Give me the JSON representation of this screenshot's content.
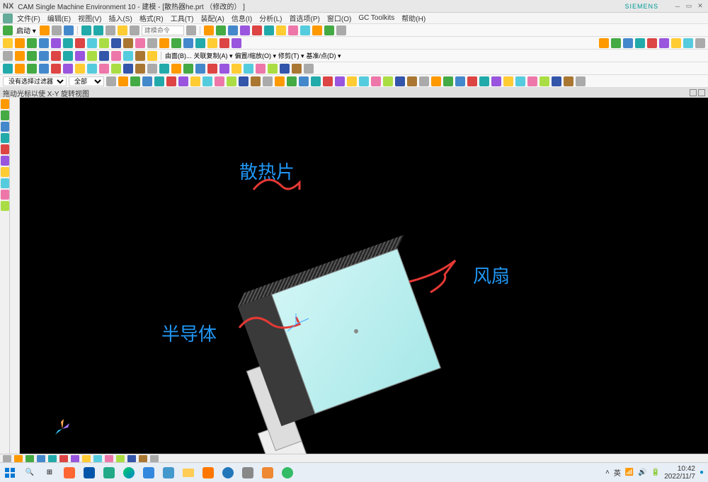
{
  "title": {
    "nx": "NX",
    "text": "CAM Single Machine Environment 10 - 建模 - [散热器he.prt （修改的） ]",
    "siemens": "SIEMENS"
  },
  "menu": {
    "items": [
      "文件(F)",
      "编辑(E)",
      "视图(V)",
      "插入(S)",
      "格式(R)",
      "工具(T)",
      "装配(A)",
      "信息(I)",
      "分析(L)",
      "首选项(P)",
      "窗口(O)",
      "GC Toolkits",
      "帮助(H)"
    ]
  },
  "toolbar1": {
    "start_label": "启动 ▾",
    "cmd_placeholder": "建模命令"
  },
  "toolbar2": {
    "labels": [
      "由面(B)...",
      "关联复制(A) ▾",
      "偏置/缩放(O) ▾",
      "修剪(T) ▾",
      "基准/点(D) ▾"
    ]
  },
  "filter": {
    "nofilter": "没有选择过滤器",
    "all": "全部"
  },
  "status": "拖动光标以使 X-Y 旋转视图",
  "annotations": {
    "heatsink": "散热片",
    "fan": "风扇",
    "semiconductor": "半导体"
  },
  "tray": {
    "ime": "英",
    "time": "10:42",
    "date": "2022/11/7"
  }
}
